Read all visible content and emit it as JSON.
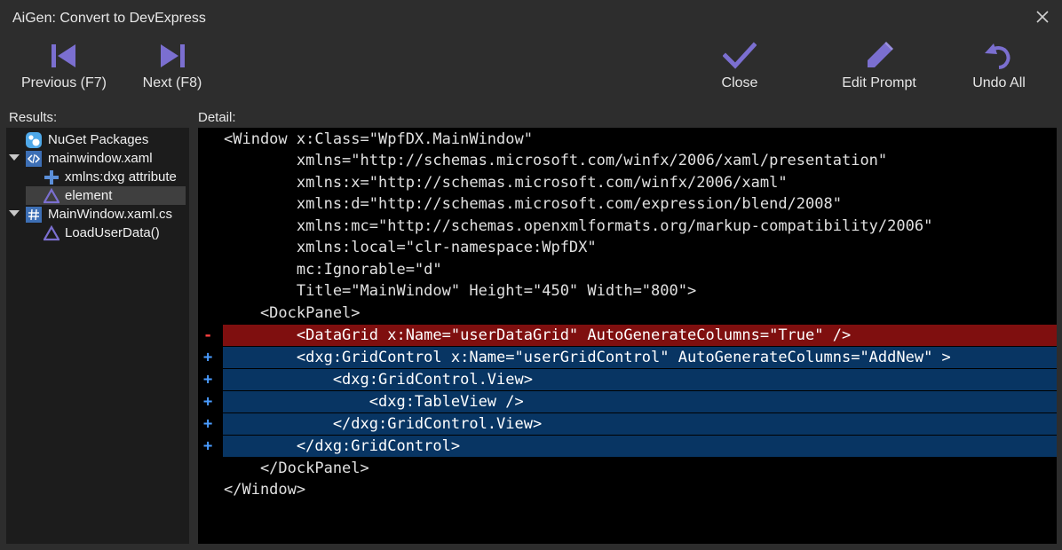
{
  "window": {
    "title": "AiGen: Convert to DevExpress"
  },
  "toolbar": {
    "previous_label": "Previous (F7)",
    "next_label": "Next (F8)",
    "close_label": "Close",
    "edit_prompt_label": "Edit Prompt",
    "undo_all_label": "Undo All"
  },
  "colors": {
    "accent": "#7b6fd0",
    "removed": "#7f0f0f",
    "added": "#083563"
  },
  "results": {
    "label": "Results:",
    "items": [
      {
        "label": "NuGet Packages",
        "icon": "nuget-icon"
      },
      {
        "label": "mainwindow.xaml",
        "icon": "xaml-file-icon"
      },
      {
        "label": "xmlns:dxg attribute",
        "icon": "add-icon"
      },
      {
        "label": "element",
        "icon": "aigen-icon"
      },
      {
        "label": "MainWindow.xaml.cs",
        "icon": "csharp-file-icon"
      },
      {
        "label": "LoadUserData()",
        "icon": "aigen-icon"
      }
    ]
  },
  "detail": {
    "label": "Detail:",
    "lines": [
      {
        "marker": "",
        "text": "<Window x:Class=\"WpfDX.MainWindow\""
      },
      {
        "marker": "",
        "text": "        xmlns=\"http://schemas.microsoft.com/winfx/2006/xaml/presentation\""
      },
      {
        "marker": "",
        "text": "        xmlns:x=\"http://schemas.microsoft.com/winfx/2006/xaml\""
      },
      {
        "marker": "",
        "text": "        xmlns:d=\"http://schemas.microsoft.com/expression/blend/2008\""
      },
      {
        "marker": "",
        "text": "        xmlns:mc=\"http://schemas.openxmlformats.org/markup-compatibility/2006\""
      },
      {
        "marker": "",
        "text": "        xmlns:local=\"clr-namespace:WpfDX\""
      },
      {
        "marker": "",
        "text": "        mc:Ignorable=\"d\""
      },
      {
        "marker": "",
        "text": "        Title=\"MainWindow\" Height=\"450\" Width=\"800\">"
      },
      {
        "marker": "",
        "text": "    <DockPanel>"
      },
      {
        "marker": "-",
        "text": "        <DataGrid x:Name=\"userDataGrid\" AutoGenerateColumns=\"True\" />"
      },
      {
        "marker": "+",
        "text": "        <dxg:GridControl x:Name=\"userGridControl\" AutoGenerateColumns=\"AddNew\" >"
      },
      {
        "marker": "+",
        "text": "            <dxg:GridControl.View>"
      },
      {
        "marker": "+",
        "text": "                <dxg:TableView />"
      },
      {
        "marker": "+",
        "text": "            </dxg:GridControl.View>"
      },
      {
        "marker": "+",
        "text": "        </dxg:GridControl>"
      },
      {
        "marker": "",
        "text": "    </DockPanel>"
      },
      {
        "marker": "",
        "text": "</Window>"
      }
    ]
  }
}
